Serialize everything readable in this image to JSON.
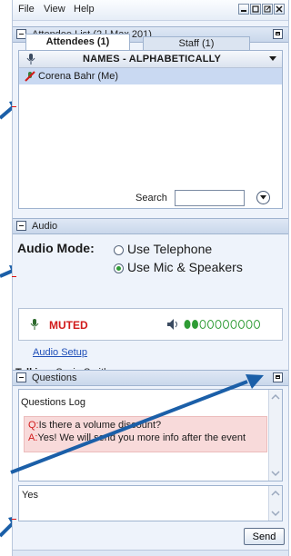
{
  "menu": {
    "items": [
      "File",
      "View",
      "Help"
    ]
  },
  "attendee_section": {
    "title": "Attendee List",
    "count_text": "(2 | Max 201)",
    "tabs": [
      {
        "label": "Attendees (1)",
        "active": true
      },
      {
        "label": "Staff (1)",
        "active": false
      }
    ],
    "column_header": "NAMES - ALPHABETICALLY",
    "attendees": [
      {
        "name": "Corena Bahr (Me)"
      }
    ],
    "search_label": "Search",
    "search_value": ""
  },
  "audio_section": {
    "title": "Audio",
    "mode_label": "Audio Mode:",
    "options": [
      {
        "label": "Use Telephone",
        "selected": false
      },
      {
        "label": "Use Mic & Speakers",
        "selected": true
      }
    ],
    "status": "MUTED",
    "level_bars": 10,
    "level_active": 2,
    "setup_link": "Audio Setup",
    "talking_label": "Talking:",
    "talking_name": "Suzie Smith"
  },
  "questions_section": {
    "title": "Questions",
    "log_title": "Questions Log",
    "question_prefix": "Q:",
    "question_text": "Is there a volume discount?",
    "answer_prefix": "A:",
    "answer_text": "Yes! We will send you more info after the event",
    "input_value": "Yes",
    "send_label": "Send"
  },
  "colors": {
    "arrow": "#1b5fa8",
    "accent_red": "#d11a1a",
    "green": "#2f9c35",
    "selection": "#c9d9f2"
  }
}
